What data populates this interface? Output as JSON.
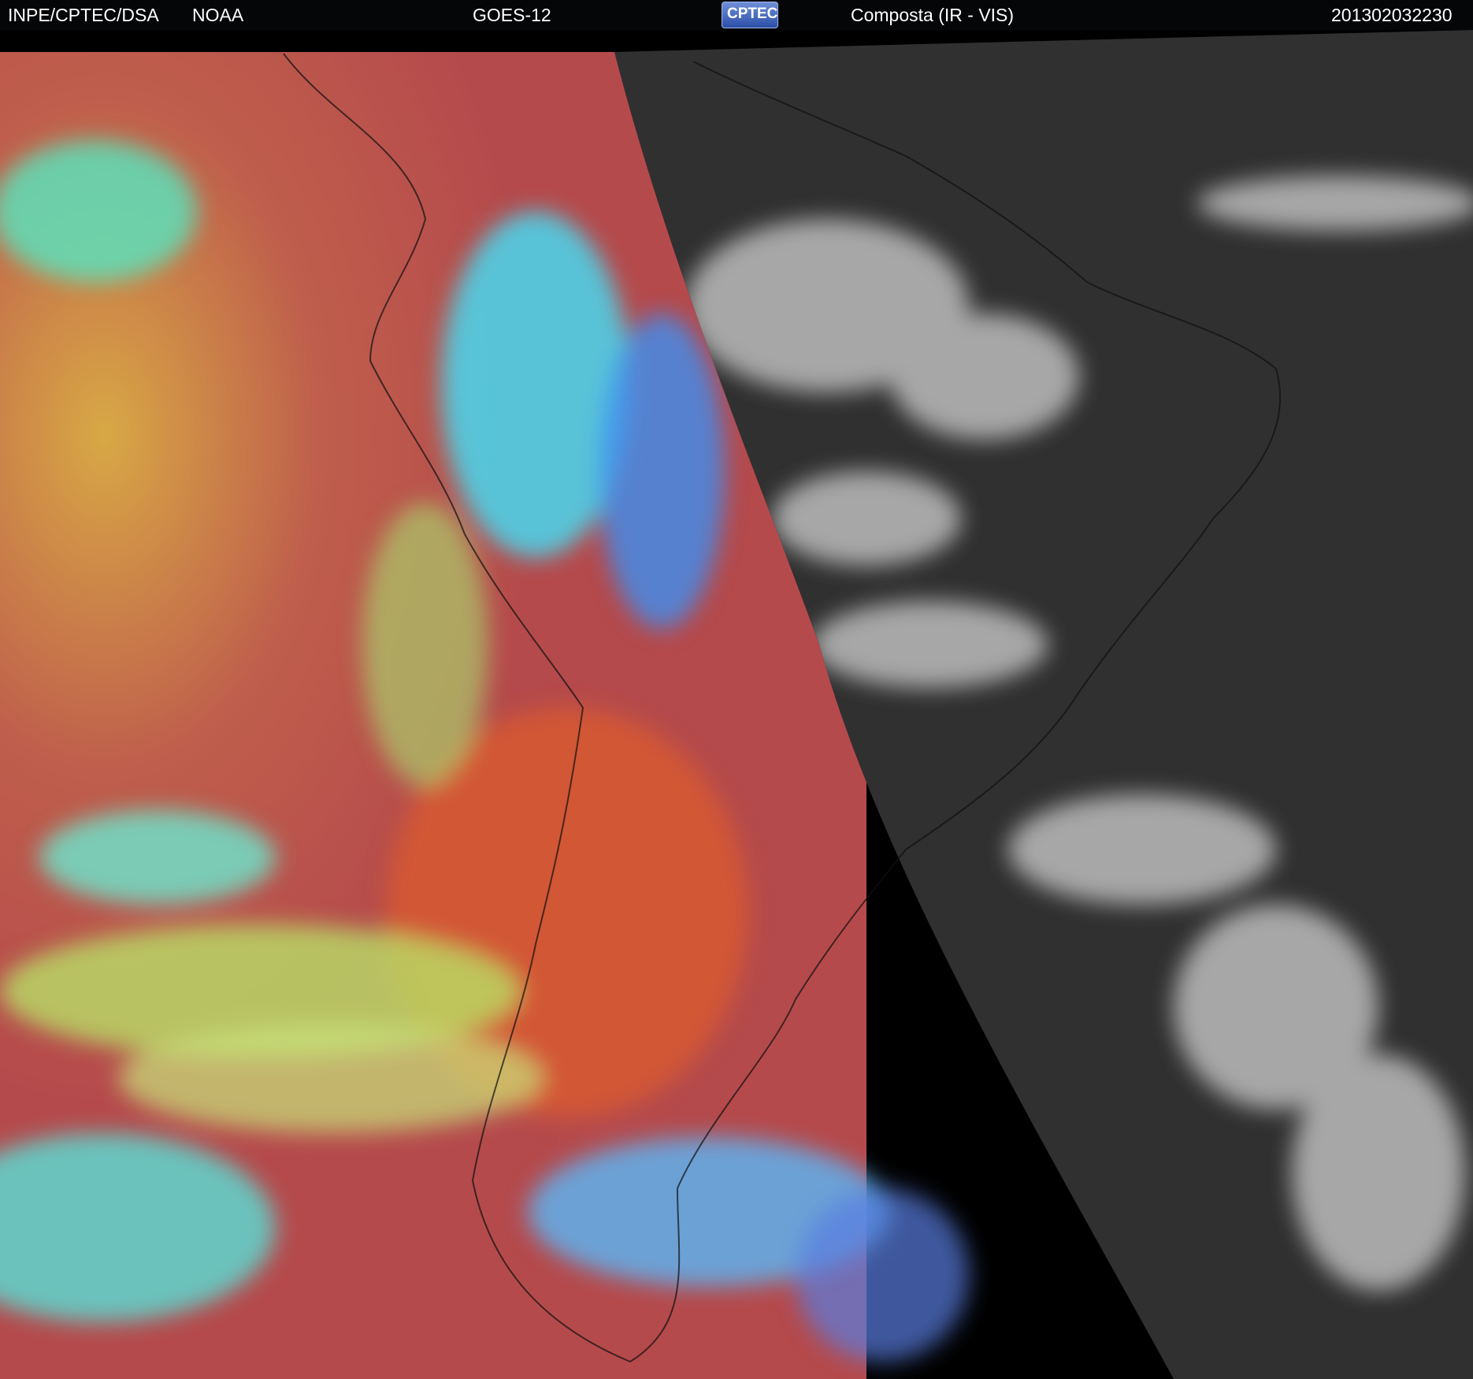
{
  "header": {
    "agency": "INPE/CPTEC/DSA",
    "provider": "NOAA",
    "satellite": "GOES-12",
    "logo_text": "CPTEC",
    "product": "Composta (IR - VIS)",
    "timestamp": "201302032230"
  },
  "colors": {
    "ocean_ir_red": "#b84a4c",
    "land_ir_orange": "#d95a30",
    "cloud_cyan": "#48d8f0",
    "cloud_yellow_green": "#b8e86a",
    "vis_night_gray": "#303030",
    "vis_cloud_white": "#d8d8d8"
  }
}
